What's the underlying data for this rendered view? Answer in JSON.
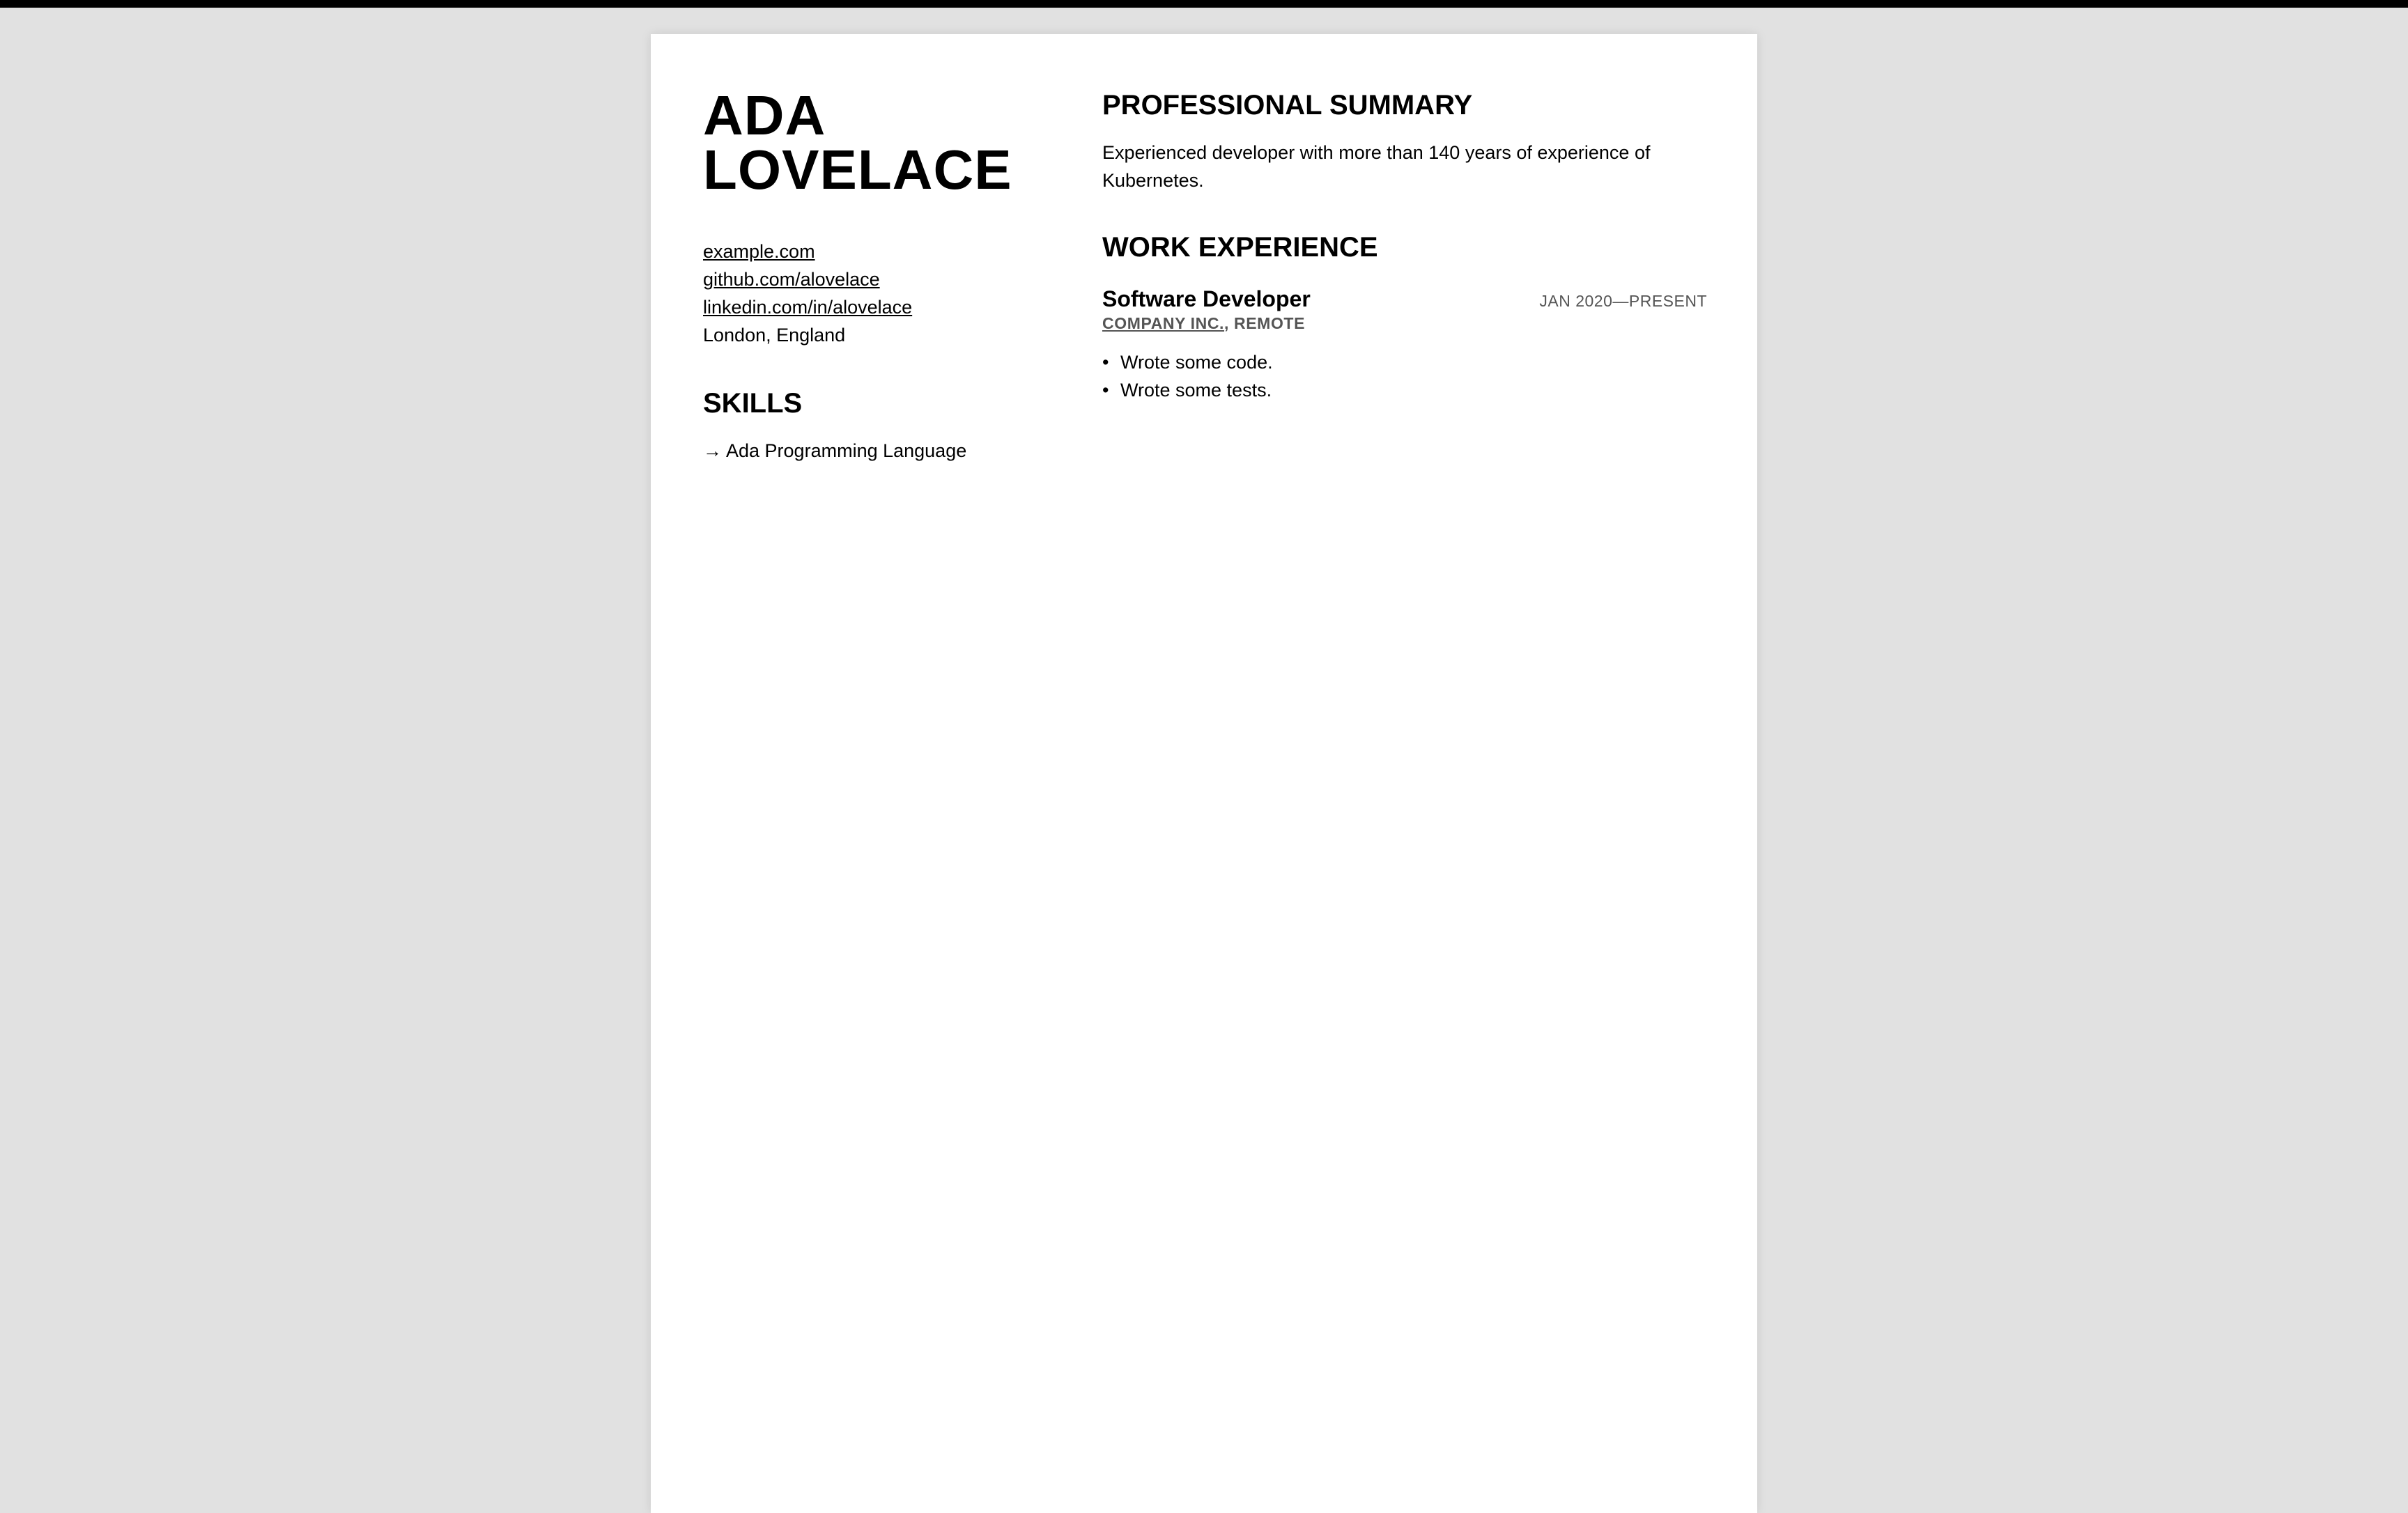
{
  "resume": {
    "name_first": "ADA",
    "name_last": "LOVELACE",
    "contact": {
      "website": "example.com",
      "github": "github.com/alovelace",
      "linkedin": "linkedin.com/in/alovelace",
      "location": "London, England"
    },
    "skills": {
      "title": "SKILLS",
      "items": [
        {
          "arrow": "→",
          "label": "Ada Programming Language"
        }
      ]
    },
    "summary": {
      "title": "PROFESSIONAL SUMMARY",
      "text": "Experienced developer with more than 140 years of experience of Kubernetes."
    },
    "work": {
      "title": "WORK EXPERIENCE",
      "jobs": [
        {
          "title": "Software Developer",
          "dates": "JAN 2020—PRESENT",
          "company": "COMPANY INC.",
          "separator": ",",
          "location": "REMOTE",
          "bullets": [
            "Wrote some code.",
            "Wrote some tests."
          ]
        }
      ]
    }
  }
}
